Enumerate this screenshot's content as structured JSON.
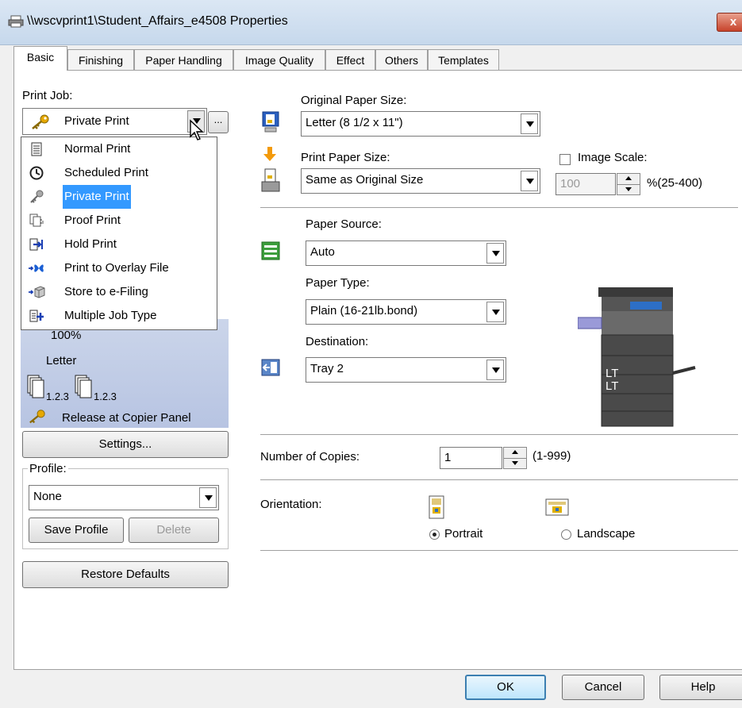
{
  "window": {
    "title": "\\\\wscvprint1\\Student_Affairs_e4508 Properties",
    "close_label": "x"
  },
  "tabs": [
    "Basic",
    "Finishing",
    "Paper Handling",
    "Image Quality",
    "Effect",
    "Others",
    "Templates"
  ],
  "print_job": {
    "label": "Print Job:",
    "selected": "Private Print",
    "more_button": "...",
    "options": [
      {
        "label": "Normal Print",
        "icon": "document-icon"
      },
      {
        "label": "Scheduled Print",
        "icon": "clock-icon"
      },
      {
        "label": "Private Print",
        "icon": "key-icon",
        "selected": true
      },
      {
        "label": "Proof Print",
        "icon": "proof-pages-icon"
      },
      {
        "label": "Hold Print",
        "icon": "hold-arrow-icon"
      },
      {
        "label": "Print to Overlay File",
        "icon": "butterfly-overlay-icon"
      },
      {
        "label": "Store to e-Filing",
        "icon": "efiling-box-icon"
      },
      {
        "label": "Multiple Job Type",
        "icon": "multiple-job-icon"
      }
    ]
  },
  "preview": {
    "scale": "100%",
    "paper": "Letter",
    "collate_a": "1.2.3",
    "collate_b": "1.2.3",
    "release": "Release at Copier Panel"
  },
  "settings_button": "Settings...",
  "profile": {
    "label": "Profile:",
    "selected": "None",
    "save_button": "Save Profile",
    "delete_button": "Delete"
  },
  "restore_button": "Restore Defaults",
  "original_paper": {
    "label": "Original Paper Size:",
    "selected": "Letter (8 1/2 x 11\")"
  },
  "print_paper": {
    "label": "Print Paper Size:",
    "selected": "Same as Original Size"
  },
  "image_scale": {
    "label": "Image Scale:",
    "value": "100",
    "range": "%(25-400)",
    "checked": false
  },
  "paper_source": {
    "label": "Paper Source:",
    "selected": "Auto"
  },
  "paper_type": {
    "label": "Paper Type:",
    "selected": "Plain (16-21lb.bond)"
  },
  "destination": {
    "label": "Destination:",
    "selected": "Tray 2"
  },
  "printer_image": {
    "tray_a": "LT",
    "tray_b": "LT"
  },
  "copies": {
    "label": "Number of Copies:",
    "value": "1",
    "range": "(1-999)"
  },
  "orientation": {
    "label": "Orientation:",
    "portrait": "Portrait",
    "landscape": "Landscape",
    "selected": "Portrait"
  },
  "dialog_buttons": {
    "ok": "OK",
    "cancel": "Cancel",
    "help": "Help"
  },
  "colors": {
    "accent": "#3399ff",
    "preview_bg": "#c3cee8",
    "title_bar": "#c6d8ec"
  }
}
